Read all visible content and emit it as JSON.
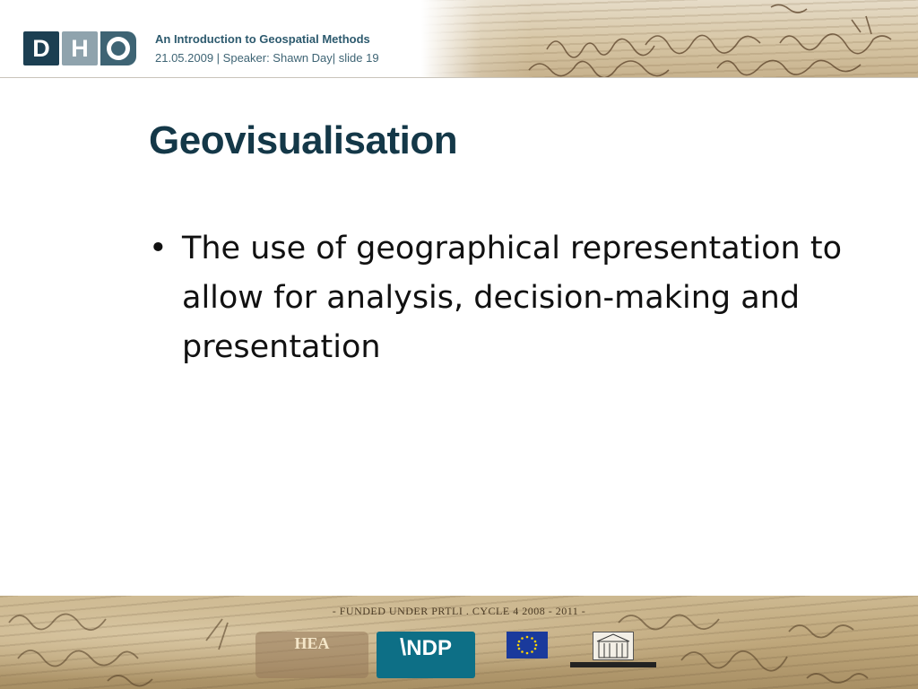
{
  "header": {
    "logo_letters": [
      "D",
      "H",
      "O"
    ],
    "presentation_title": "An Introduction to Geospatial Methods",
    "subtitle": "21.05.2009 | Speaker: Shawn Day| slide 19"
  },
  "slide": {
    "title": "Geovisualisation",
    "bullets": [
      "The use of geographical representation to allow for analysis, decision-making and presentation"
    ]
  },
  "footer": {
    "funded_text": "- FUNDED UNDER PRTLI . CYCLE 4 2008 - 2011 -",
    "funder_logos": {
      "hea": "HEA",
      "ndp": "NDP"
    }
  },
  "colors": {
    "brand_dark": "#1c3f52",
    "brand_light": "#8fa3ad",
    "title": "#143848"
  }
}
